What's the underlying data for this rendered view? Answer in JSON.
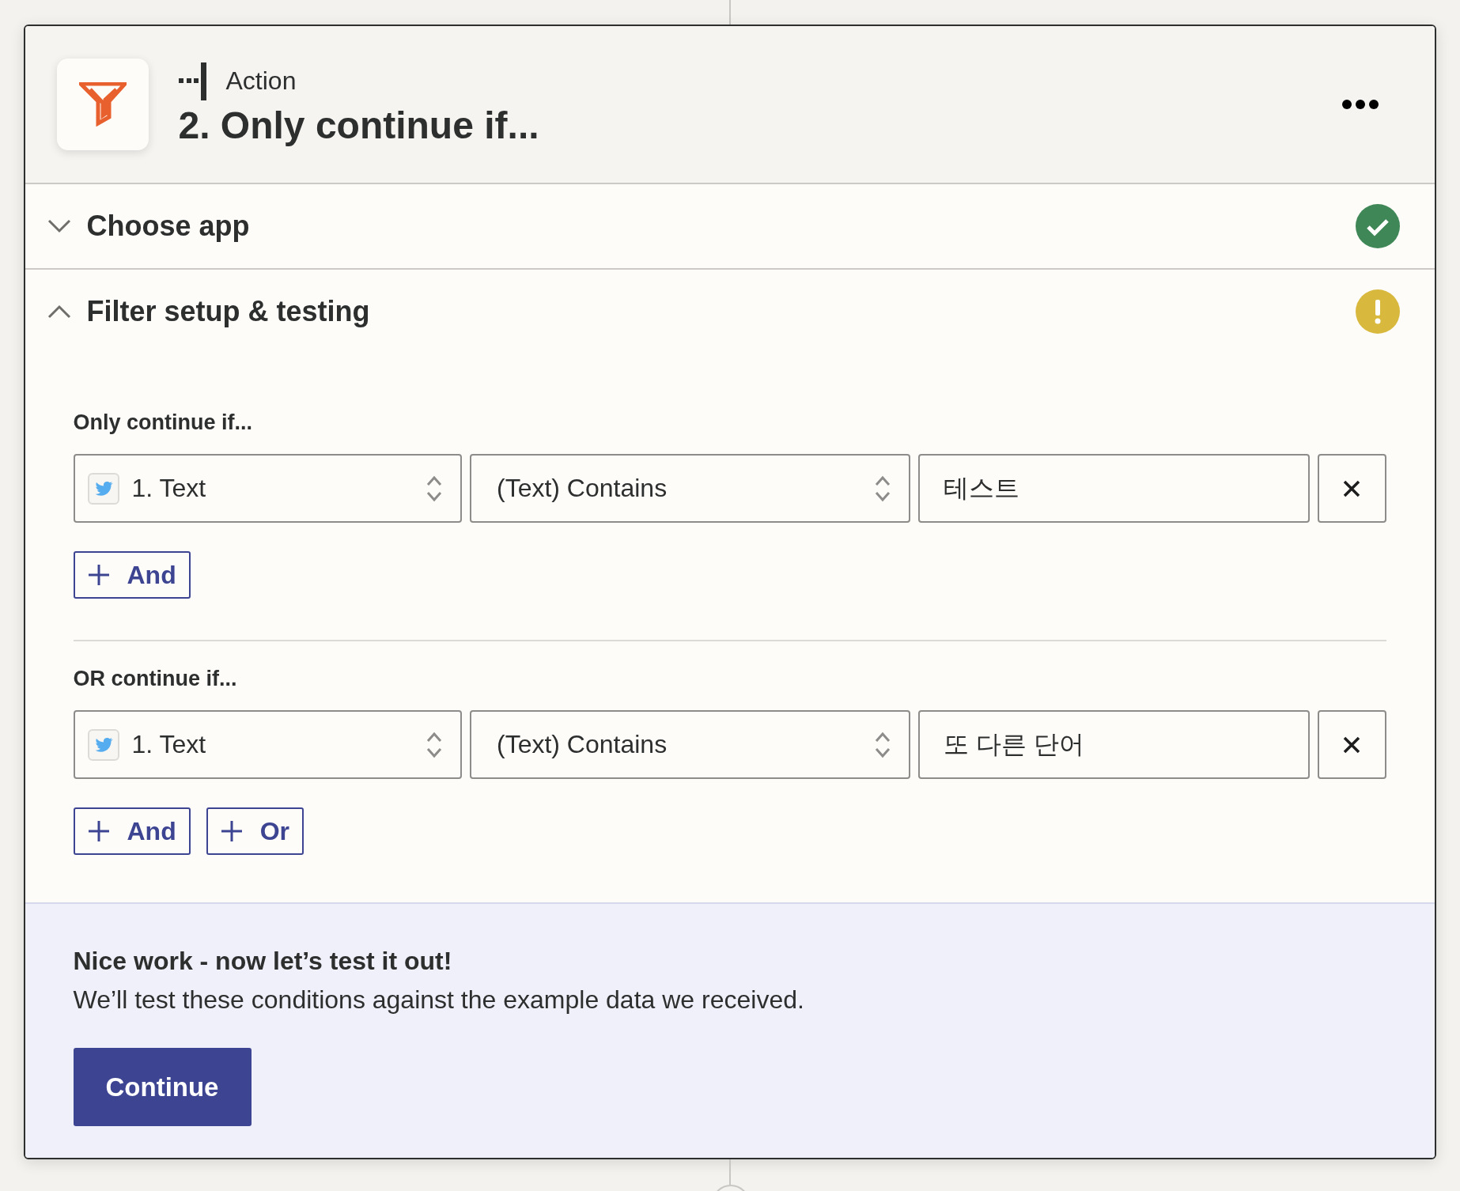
{
  "step": {
    "type_label": "Action",
    "title": "2. Only continue if..."
  },
  "sections": [
    {
      "title": "Choose app",
      "expanded": false,
      "complete": true
    },
    {
      "title": "Filter setup & testing",
      "expanded": true,
      "complete": false,
      "filter_groups": [
        {
          "label": "Only continue if...",
          "conditions": [
            {
              "field": "1. Text",
              "operator": "(Text) Contains",
              "value": "테스트"
            }
          ],
          "buttons": [
            "And"
          ]
        },
        {
          "label": "OR continue if...",
          "conditions": [
            {
              "field": "1. Text",
              "operator": "(Text) Contains",
              "value": "또 다른 단어"
            }
          ],
          "buttons": [
            "And",
            "Or"
          ]
        }
      ],
      "footer": {
        "heading": "Nice work - now let’s test it out!",
        "text": "We’ll test these conditions against the example data we received.",
        "button": "Continue"
      }
    }
  ]
}
